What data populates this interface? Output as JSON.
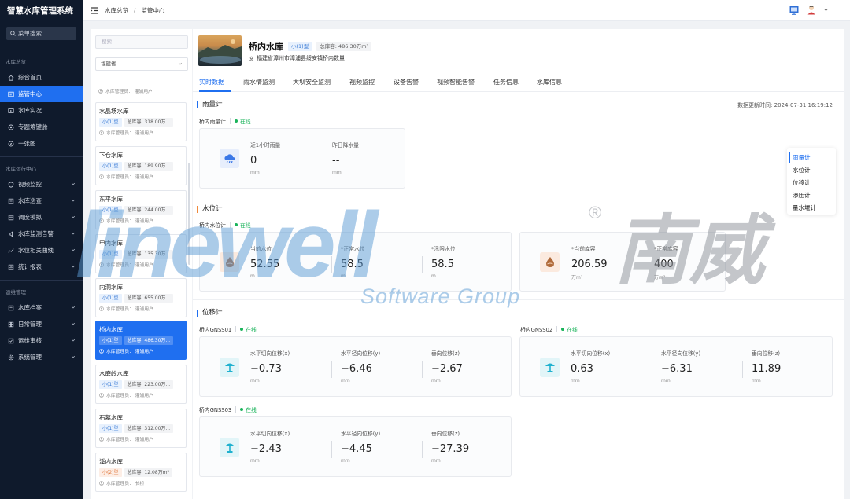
{
  "app": {
    "title": "智慧水库管理系统",
    "menu_search": "菜单搜索"
  },
  "sidebar": {
    "groups": [
      {
        "title": "水库总览",
        "items": [
          {
            "label": "综合首页",
            "icon": "home-icon",
            "active": false,
            "expandable": false
          },
          {
            "label": "监管中心",
            "icon": "monitor-icon",
            "active": true,
            "expandable": false
          },
          {
            "label": "水库实况",
            "icon": "video-icon",
            "active": false,
            "expandable": false
          },
          {
            "label": "专题筹键舱",
            "icon": "target-icon",
            "active": false,
            "expandable": false
          },
          {
            "label": "一张图",
            "icon": "map-icon",
            "active": false,
            "expandable": false
          }
        ]
      },
      {
        "title": "水库运行中心",
        "items": [
          {
            "label": "视频监控",
            "icon": "shield-icon",
            "active": false,
            "expandable": true
          },
          {
            "label": "水库巡查",
            "icon": "patrol-icon",
            "active": false,
            "expandable": true
          },
          {
            "label": "调度模拟",
            "icon": "dispatch-icon",
            "active": false,
            "expandable": true
          },
          {
            "label": "水库监测告警",
            "icon": "alarm-icon",
            "active": false,
            "expandable": true
          },
          {
            "label": "水位相关曲线",
            "icon": "curve-icon",
            "active": false,
            "expandable": true
          },
          {
            "label": "统计报表",
            "icon": "report-icon",
            "active": false,
            "expandable": true
          }
        ]
      },
      {
        "title": "运维管理",
        "items": [
          {
            "label": "水库档案",
            "icon": "archive-icon",
            "active": false,
            "expandable": true
          },
          {
            "label": "日常管理",
            "icon": "daily-icon",
            "active": false,
            "expandable": true
          },
          {
            "label": "运维审核",
            "icon": "audit-icon",
            "active": false,
            "expandable": true
          },
          {
            "label": "系统管理",
            "icon": "gear-icon",
            "active": false,
            "expandable": true
          }
        ]
      }
    ]
  },
  "breadcrumb": {
    "items": [
      "水库总览",
      "监管中心"
    ],
    "separator": "/"
  },
  "list": {
    "search_placeholder": "搜索",
    "province": "福建省",
    "partial_manager": "水库管理员：  灌浦用户",
    "reservoirs": [
      {
        "name": "水晶场水库",
        "type": "小(1)型",
        "capacity": "总库容:  318.00万...",
        "manager": "水库管理员：  灌浦用户",
        "active": false,
        "type_color": "blue"
      },
      {
        "name": "下仓水库",
        "type": "小(1)型",
        "capacity": "总库容:  189.90万...",
        "manager": "水库管理员：  灌浦用户",
        "active": false,
        "type_color": "blue"
      },
      {
        "name": "东平水库",
        "type": "小(1)型",
        "capacity": "总库容:  244.00万...",
        "manager": "水库管理员：  灌浦用户",
        "active": false,
        "type_color": "blue"
      },
      {
        "name": "申内水库",
        "type": "小(1)型",
        "capacity": "总库容:  135.30万...",
        "manager": "水库管理员：  灌浦用户",
        "active": false,
        "type_color": "blue"
      },
      {
        "name": "内洞水库",
        "type": "小(1)型",
        "capacity": "总库容:  655.00万...",
        "manager": "水库管理员：  灌浦用户",
        "active": false,
        "type_color": "blue"
      },
      {
        "name": "桥内水库",
        "type": "小(1)型",
        "capacity": "总库容:  486.30万...",
        "manager": "水库管理员：  灌浦用户",
        "active": true,
        "type_color": "blue"
      },
      {
        "name": "水磨岭水库",
        "type": "小(1)型",
        "capacity": "总库容:  223.00万...",
        "manager": "水库管理员：  灌浦用户",
        "active": false,
        "type_color": "blue"
      },
      {
        "name": "石墓水库",
        "type": "小(1)型",
        "capacity": "总库容:  312.00万...",
        "manager": "水库管理员：  灌浦用户",
        "active": false,
        "type_color": "blue"
      },
      {
        "name": "溪内水库",
        "type": "小(2)型",
        "capacity": "总库容:  12.08万m³",
        "manager": "水库管理员：  长桥",
        "active": false,
        "type_color": "orange"
      }
    ]
  },
  "header": {
    "name": "桥内水库",
    "type": "小(1)型",
    "capacity": "总库容:  486.30万m³",
    "address": "福建省漳州市漳浦县绥安镇桥内数量"
  },
  "tabs": [
    {
      "label": "实时数据",
      "active": true
    },
    {
      "label": "雨水情监测",
      "active": false
    },
    {
      "label": "大坝安全监测",
      "active": false
    },
    {
      "label": "视频监控",
      "active": false
    },
    {
      "label": "设备告警",
      "active": false
    },
    {
      "label": "视频智能告警",
      "active": false
    },
    {
      "label": "任务信息",
      "active": false
    },
    {
      "label": "水库信息",
      "active": false
    }
  ],
  "update_time": "数据更新时间:  2024-07-31 16:19:12",
  "rain": {
    "section": "雨量计",
    "device": "桥内雨量计",
    "status": "在线",
    "metrics": [
      {
        "label": "近1小时雨量",
        "value": "0",
        "unit": "mm"
      },
      {
        "label": "昨日降水量",
        "value": "--",
        "unit": "mm"
      }
    ]
  },
  "water": {
    "section": "水位计",
    "device": "桥内水位计",
    "status": "在线",
    "metrics": [
      {
        "label": "当前水位",
        "value": "52.55",
        "unit": "m"
      },
      {
        "label": "*正常水位",
        "value": "58.5",
        "unit": "m"
      },
      {
        "label": "*汛限水位",
        "value": "58.5",
        "unit": "m"
      },
      {
        "label": "*当前库容",
        "value": "206.59",
        "unit": "万m³"
      },
      {
        "label": "*正常库容",
        "value": "400",
        "unit": "万m³"
      }
    ]
  },
  "displacement": {
    "section": "位移计",
    "devices": [
      {
        "name": "桥内GNSS01",
        "status": "在线",
        "metrics": [
          {
            "label": "水平切向位移(x)",
            "value": "−0.73",
            "unit": "mm"
          },
          {
            "label": "水平径向位移(y)",
            "value": "−6.46",
            "unit": "mm"
          },
          {
            "label": "垂向位移(z)",
            "value": "−2.67",
            "unit": "mm"
          }
        ]
      },
      {
        "name": "桥内GNSS02",
        "status": "在线",
        "metrics": [
          {
            "label": "水平切向位移(x)",
            "value": "0.63",
            "unit": "mm"
          },
          {
            "label": "水平径向位移(y)",
            "value": "−6.31",
            "unit": "mm"
          },
          {
            "label": "垂向位移(z)",
            "value": "11.89",
            "unit": "mm"
          }
        ]
      },
      {
        "name": "桥内GNSS03",
        "status": "在线",
        "metrics": [
          {
            "label": "水平切向位移(x)",
            "value": "−2.43",
            "unit": "mm"
          },
          {
            "label": "水平径向位移(y)",
            "value": "−4.45",
            "unit": "mm"
          },
          {
            "label": "垂向位移(z)",
            "value": "−27.39",
            "unit": "mm"
          }
        ]
      }
    ]
  },
  "anchor_nav": {
    "items": [
      {
        "label": "雨量计",
        "active": true
      },
      {
        "label": "水位计",
        "active": false
      },
      {
        "label": "位移计",
        "active": false
      },
      {
        "label": "渗压计",
        "active": false
      },
      {
        "label": "量水堰计",
        "active": false
      }
    ]
  },
  "watermark": {
    "brand": "linewell",
    "cn": "南威",
    "sub": "Software Group",
    "reg": "®"
  },
  "colors": {
    "accent": "#1f6ff0",
    "sidebar_bg": "#0f1a2c",
    "online": "#19b35a",
    "water_section": "#f08a3c"
  }
}
